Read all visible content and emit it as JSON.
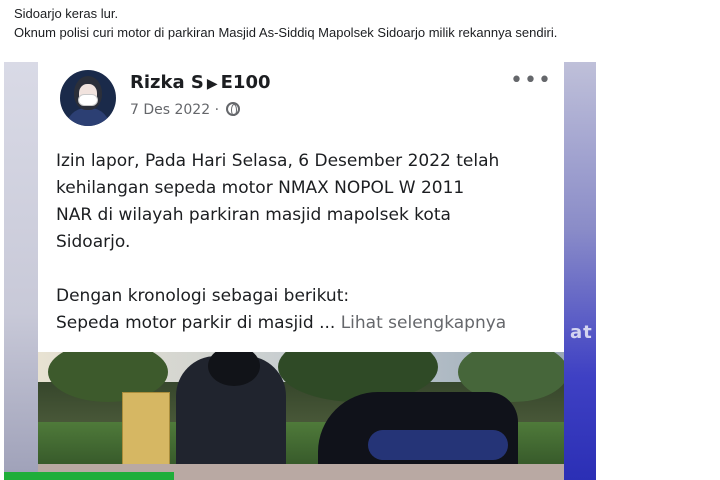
{
  "caption": {
    "line1": "Sidoarjo keras lur.",
    "line2": "Oknum polisi curi motor di parkiran Masjid As-Siddiq Mapolsek Sidoarjo milik rekannya sendiri."
  },
  "post": {
    "author": "Rizka S",
    "separator_icon": "play-arrow-icon",
    "group": "E100",
    "date": "7 Des 2022",
    "date_sep": "·",
    "privacy_icon": "globe-icon",
    "more_icon": "more-dots-icon",
    "more_glyph": "•••",
    "body": {
      "line1": "Izin lapor, Pada Hari Selasa, 6 Desember 2022 telah",
      "line2": "kehilangan sepeda motor NMAX NOPOL W 2011",
      "line3": "NAR di wilayah parkiran masjid mapolsek kota",
      "line4": "Sidoarjo.",
      "line5": "Dengan kronologi sebagai berikut:",
      "line6": "Sepeda motor parkir di masjid ...",
      "see_more": "Lihat selengkapnya"
    }
  },
  "watermark_fragment": "at",
  "colors": {
    "text": "#1c1e21",
    "secondary": "#65676b",
    "accent_green": "#1fae3a",
    "accent_blue": "#3f41c4"
  }
}
